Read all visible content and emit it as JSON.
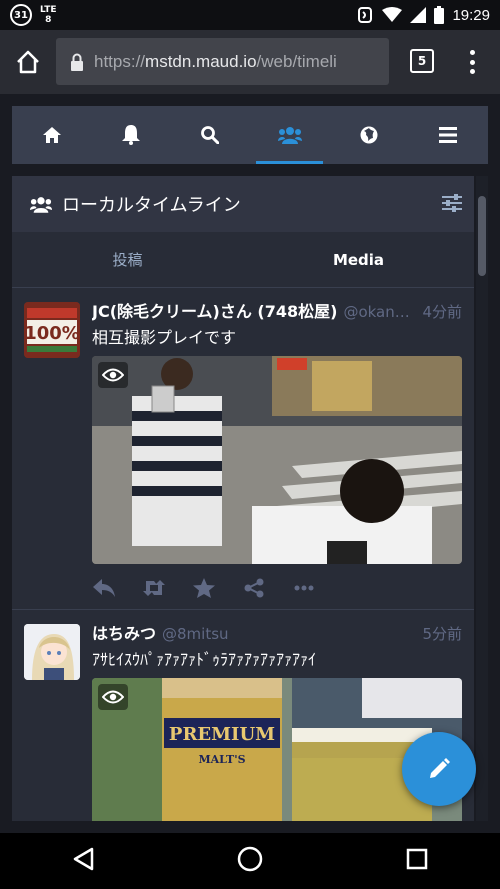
{
  "statusbar": {
    "notification_badge": "31",
    "network": "LTE",
    "network_sub": "8",
    "time": "19:29"
  },
  "browser": {
    "url_prefix": "https://",
    "url_host": "mstdn.maud.io",
    "url_path": "/web/timeli",
    "tab_count": "5"
  },
  "navbar": {
    "items": [
      {
        "icon": "home-icon"
      },
      {
        "icon": "bell-icon"
      },
      {
        "icon": "search-icon"
      },
      {
        "icon": "users-icon",
        "active": true
      },
      {
        "icon": "globe-icon"
      },
      {
        "icon": "hamburger-icon"
      }
    ]
  },
  "column": {
    "title": "ローカルタイムライン",
    "tabs": [
      {
        "label": "投稿"
      },
      {
        "label": "Media",
        "active": true
      }
    ]
  },
  "statuses": [
    {
      "display_name": "JC(除毛クリーム)さん (748松屋)",
      "acct": "@okan…",
      "time": "4分前",
      "text": "相互撮影プレイです",
      "avatar_label": "100%"
    },
    {
      "display_name": "はちみつ",
      "acct": "@8mitsu",
      "time": "5分前",
      "text": "ｱｻﾋｲｽｳﾊﾟｧｱｧｱｧﾄﾞｩﾗｱｧｱｧｱｧｱｧｱｧｲ"
    }
  ],
  "colors": {
    "accent": "#2b90d9",
    "background": "#191b22",
    "column_bg": "#282c37",
    "nav_bg": "#393f4f"
  }
}
